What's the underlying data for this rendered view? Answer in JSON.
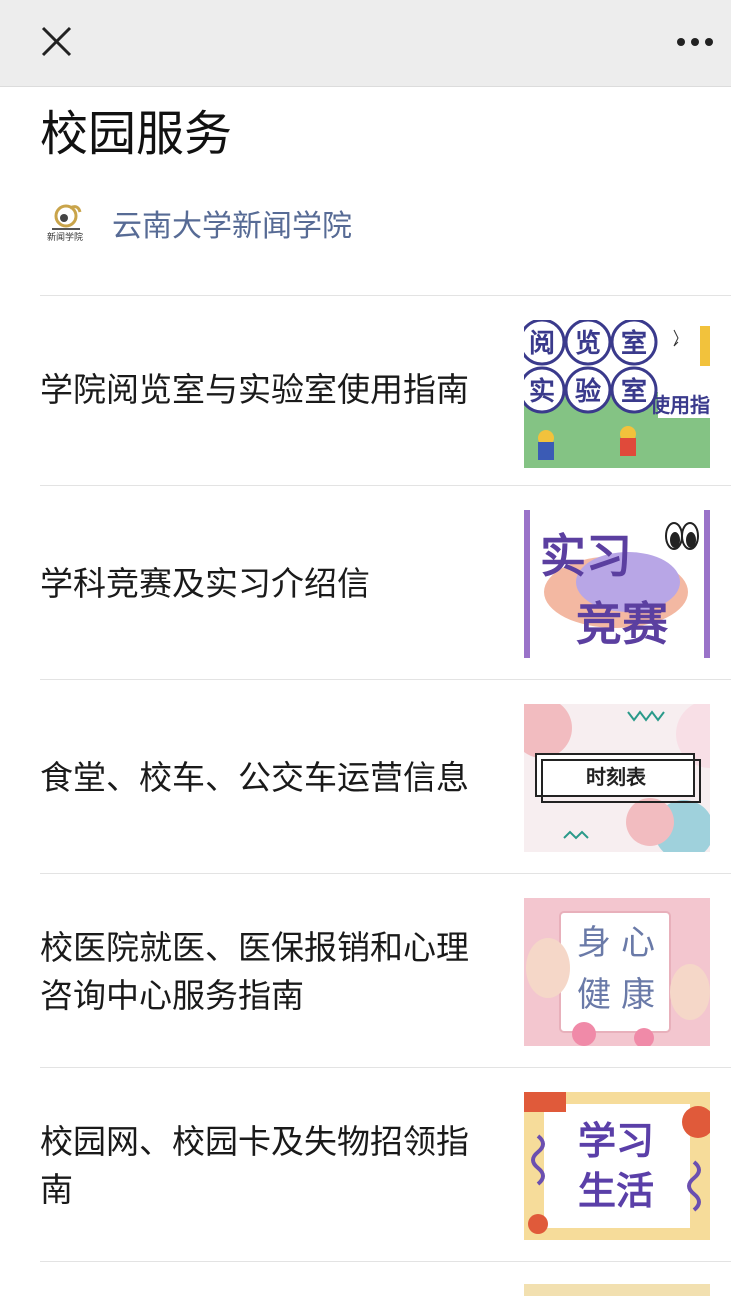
{
  "header": {
    "close_icon": "close-icon",
    "more_icon": "more-icon"
  },
  "article": {
    "title": "校园服务",
    "account_name": "云南大学新闻学院",
    "avatar_label": "新闻学院"
  },
  "items": [
    {
      "title": "学院阅览室与实验室使用指南",
      "thumb_texts": [
        "阅",
        "览",
        "室",
        "实",
        "验",
        "室",
        "使用指"
      ]
    },
    {
      "title": "学科竞赛及实习介绍信",
      "thumb_texts": [
        "实习",
        "竞赛"
      ]
    },
    {
      "title": "食堂、校车、公交车运营信息",
      "thumb_texts": [
        "时刻表"
      ]
    },
    {
      "title_line1": "校医院就医、医保报销和心理",
      "title_line2": "咨询中心服务指南",
      "thumb_texts": [
        "身",
        "心",
        "健",
        "康"
      ]
    },
    {
      "title_line1": "校园网、校园卡及失物招领指",
      "title_line2": "南",
      "thumb_texts": [
        "学习",
        "生活"
      ]
    }
  ],
  "colors": {
    "link_blue": "#576b95",
    "header_bg": "#ededed",
    "purple": "#5b3fa0",
    "green": "#7fbf7a"
  }
}
